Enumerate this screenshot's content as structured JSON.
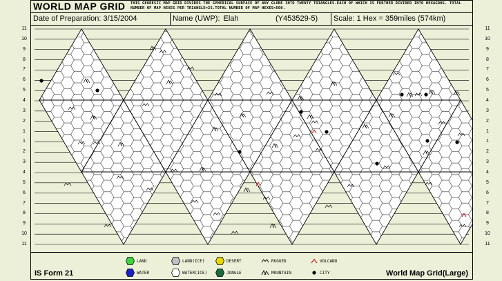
{
  "header": {
    "title": "WORLD MAP GRID",
    "description": "THIS GEODESIC MAP GRID DIVIDES THE SPHERICAL SURFACE OF ANY GLOBE INTO TWENTY TRIANGLES.EACH OF WHICH IS FURTHER DIVIDED INTO HEXAGONS. TOTAL NUMBER OF MAP HEXES PER TRIANGLE=25.TOTAL NUMBER OF MAP HEXES=500."
  },
  "info": {
    "date_label": "Date of Preparation:",
    "date_value": "3/15/2004",
    "name_label": "Name (UWP):",
    "name_value": "Elah",
    "uwp_value": "(Y453529-5)",
    "scale_label": "Scale: 1 Hex = 359miles (574km)"
  },
  "row_labels": [
    "11",
    "10",
    "9",
    "8",
    "7",
    "6",
    "5",
    "4",
    "3",
    "2",
    "1",
    "1",
    "2",
    "3",
    "4",
    "5",
    "6",
    "7",
    "8",
    "9",
    "10",
    "11"
  ],
  "legend": {
    "land": "LAND",
    "water": "WATER",
    "land_ice": "LAND(ICE)",
    "water_ice": "WATER(ICE)",
    "desert": "DESERT",
    "jungle": "JUNGLE",
    "rugged": "RUGGED",
    "mountain": "MOUNTAIN",
    "volcano": "VOLCANO",
    "city": "CITY"
  },
  "colors": {
    "background": "#ecf0d8",
    "land": "#3fd43f",
    "water": "#1a20c8",
    "land_ice": "#c0c0c8",
    "water_ice": "#ffffff",
    "desert": "#e8d800",
    "jungle": "#1a6a40",
    "volcano": "#d01010"
  },
  "footer": {
    "form": "IS Form 21",
    "name": "World Map Grid(Large)"
  }
}
